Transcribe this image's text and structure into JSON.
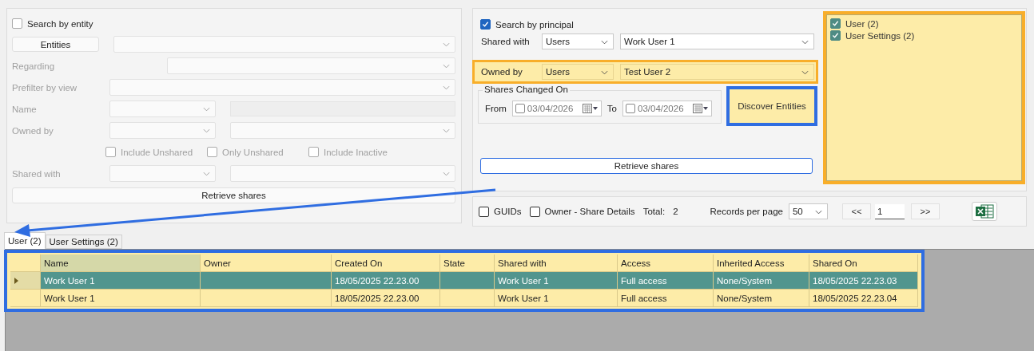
{
  "entity_search": {
    "disabled": true,
    "checkbox": {
      "label": "Search by entity",
      "checked": false
    },
    "rows": [
      {
        "kind": "button-combo",
        "button": "Entities"
      },
      {
        "kind": "combo",
        "label": "Regarding"
      },
      {
        "kind": "combo",
        "label": "Prefilter by view"
      },
      {
        "kind": "combo-text",
        "label": "Name"
      },
      {
        "kind": "combo-combo",
        "label": "Owned by"
      },
      {
        "kind": "checks",
        "options": [
          {
            "label": "Include Unshared",
            "checked": false
          },
          {
            "label": "Only Unshared",
            "checked": false
          },
          {
            "label": "Include Inactive",
            "checked": false
          }
        ]
      },
      {
        "kind": "combo-combo",
        "label": "Shared with"
      },
      {
        "kind": "button",
        "label": "Retrieve shares"
      }
    ]
  },
  "principal_search": {
    "checkbox": {
      "label": "Search by principal",
      "checked": true
    },
    "shared_with": {
      "label": "Shared with",
      "type": "Users",
      "value": "Work User 1",
      "highlighted": false
    },
    "owned_by": {
      "label": "Owned by",
      "type": "Users",
      "value": "Test User 2",
      "highlighted": true
    },
    "date_group": {
      "title": "Shares Changed On",
      "from": {
        "label": "From",
        "value": "03/04/2026",
        "checked": false
      },
      "to": {
        "label": "To",
        "value": "03/04/2026",
        "checked": false
      }
    },
    "discover_button": {
      "label": "Discover Entities",
      "highlighted": true
    },
    "retrieve_button": "Retrieve shares"
  },
  "entity_list": {
    "highlighted": true,
    "items": [
      {
        "label": "User (2)",
        "checked": true
      },
      {
        "label": "User Settings (2)",
        "checked": true
      }
    ]
  },
  "pager": {
    "options": [
      {
        "label": "GUIDs",
        "checked": false
      },
      {
        "label": "Owner - Share Details",
        "checked": false
      }
    ],
    "total_label": "Total:",
    "total": "2",
    "records_label": "Records per page",
    "records_value": "50",
    "prev": "<<",
    "page": "1",
    "next": ">>"
  },
  "tabs": [
    {
      "label": "User (2)",
      "selected": true
    },
    {
      "label": "User Settings (2)",
      "selected": false
    }
  ],
  "table": {
    "highlighted": true,
    "columns": [
      "Name",
      "Owner",
      "Created On",
      "State",
      "Shared with",
      "Access",
      "Inherited Access",
      "Shared On"
    ],
    "rows": [
      {
        "selected": true,
        "current": true,
        "cells": [
          "Work User 1",
          null,
          "18/05/2025 22.23.00",
          null,
          "Work User 1",
          "Full access",
          "None/System",
          "18/05/2025 22.23.03"
        ]
      },
      {
        "selected": false,
        "current": false,
        "cells": [
          "Work User 1",
          null,
          "18/05/2025 22.23.00",
          null,
          "Work User 1",
          "Full access",
          "None/System",
          "18/05/2025 22.23.04"
        ]
      }
    ]
  }
}
